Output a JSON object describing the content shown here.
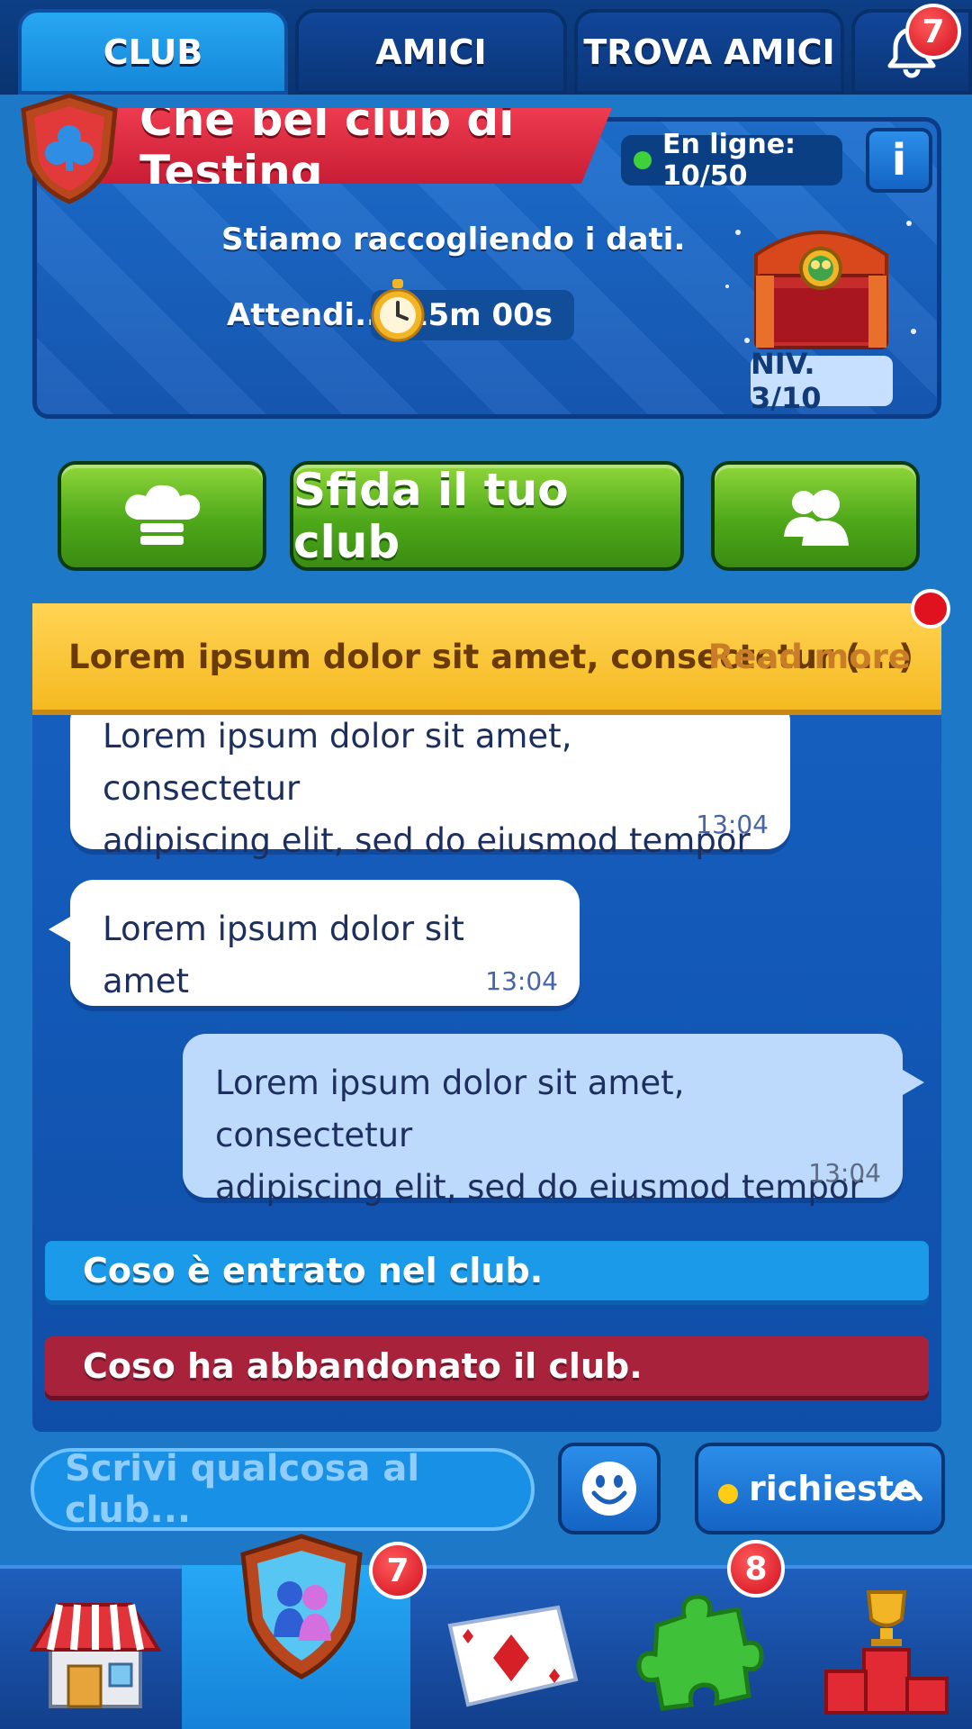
{
  "top_tabs": {
    "club_label": "CLUB",
    "friends_label": "AMICI",
    "find_friends_label": "TROVA AMICI",
    "notifications_count": "7"
  },
  "club": {
    "name": "Che bel club di Testing",
    "online_label": "En ligne: 10/50",
    "info_label": "i",
    "status_line": "Stiamo raccogliendo i dati.",
    "wait_label": "Attendi...",
    "timer": "15m 00s",
    "level": "NIV. 3/10"
  },
  "actions": {
    "challenge_label": "Sfida il tuo club",
    "chef_icon": "chef-hat-icon",
    "members_icon": "members-icon"
  },
  "notice": {
    "text": "Lorem ipsum dolor sit amet, consectetur (...)",
    "read_more": "Read more"
  },
  "messages": [
    {
      "line1": "Lorem ipsum dolor sit amet, consectetur",
      "line2": "adipiscing elit, sed do eiusmod tempor",
      "time": "13:04",
      "side": "left"
    },
    {
      "line1": "Lorem ipsum dolor sit amet",
      "time": "13:04",
      "side": "left"
    },
    {
      "line1": "Lorem ipsum dolor sit amet, consectetur",
      "line2": "adipiscing elit, sed do eiusmod tempor",
      "time": "13:04",
      "side": "right"
    }
  ],
  "system_messages": {
    "joined": "Coso è entrato nel club.",
    "left": "Coso ha abbandonato il club."
  },
  "composer": {
    "placeholder": "Scrivi qualcosa al club...",
    "requests_label": "richieste"
  },
  "bottom_nav": {
    "shop_icon": "shop-icon",
    "club_badge": "7",
    "cards_icon": "cards-icon",
    "puzzle_badge": "8",
    "leaderboard_icon": "podium-trophy-icon"
  },
  "colors": {
    "accent_green": "#4ea81a",
    "notice_yellow": "#f5b921",
    "joined_blue": "#1a9ae8",
    "left_red": "#a8223c",
    "badge_red": "#d10f1f"
  }
}
